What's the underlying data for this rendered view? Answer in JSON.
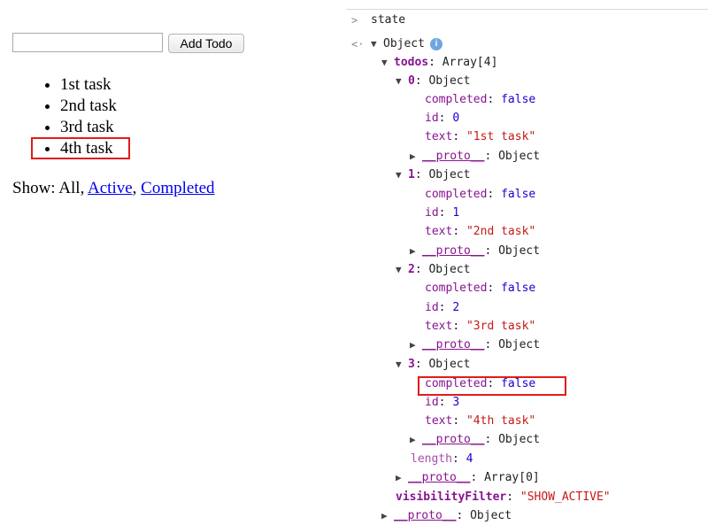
{
  "app": {
    "input_value": "",
    "add_button_label": "Add Todo",
    "todos": [
      "1st task",
      "2nd task",
      "3rd task",
      "4th task"
    ],
    "filter": {
      "prefix": "Show:",
      "all": "All",
      "sep1": ",",
      "active": "Active",
      "sep2": ",",
      "completed": "Completed"
    }
  },
  "console": {
    "prompt_symbol": ">",
    "result_symbol": "<·",
    "command": "state",
    "root_label": "Object",
    "info_icon": "i",
    "todos_key": "todos",
    "todos_value": "Array[4]",
    "items": [
      {
        "index": "0",
        "label": "Object",
        "completed": "false",
        "id": "0",
        "text": "\"1st task\""
      },
      {
        "index": "1",
        "label": "Object",
        "completed": "false",
        "id": "1",
        "text": "\"2nd task\""
      },
      {
        "index": "2",
        "label": "Object",
        "completed": "false",
        "id": "2",
        "text": "\"3rd task\""
      },
      {
        "index": "3",
        "label": "Object",
        "completed": "false",
        "id": "3",
        "text": "\"4th task\""
      }
    ],
    "completed_key": "completed",
    "id_key": "id",
    "text_key": "text",
    "proto_key": "__proto__",
    "proto_object": "Object",
    "length_key": "length",
    "length_value": "4",
    "array_proto_value": "Array[0]",
    "visibility_key": "visibilityFilter",
    "visibility_value": "\"SHOW_ACTIVE\"",
    "colors": {
      "key": "#881391",
      "number": "#1c00cf",
      "string": "#c41a16",
      "highlight": "#e21b1b"
    }
  }
}
